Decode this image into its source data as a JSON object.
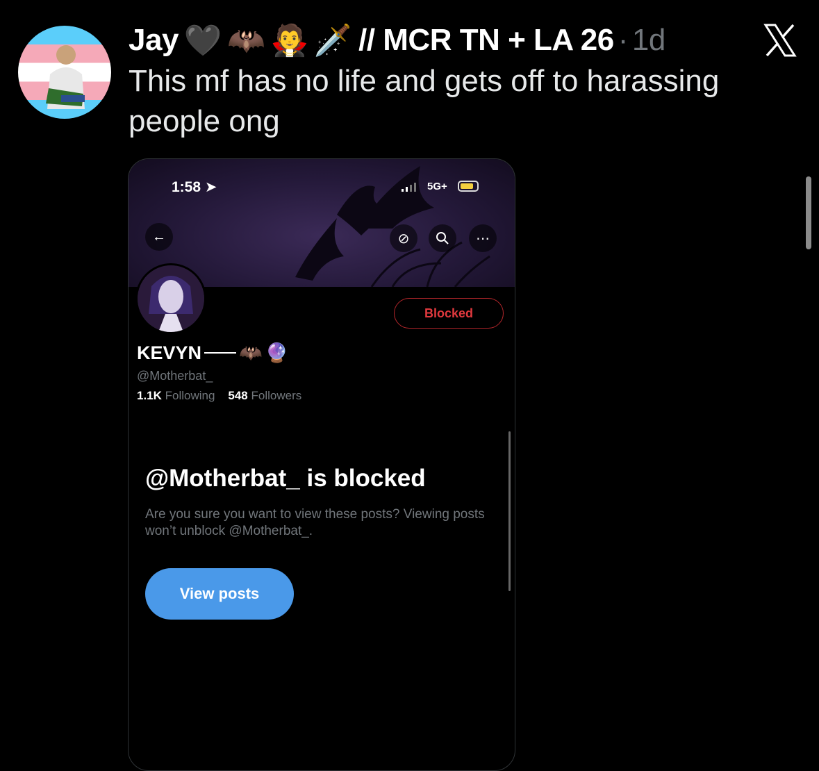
{
  "tweet": {
    "author_name": "Jay",
    "author_emojis": [
      "🖤",
      "🦇",
      "🧛",
      "🗡️"
    ],
    "author_suffix": "// MCR TN + LA 26",
    "separator": "·",
    "age": "1d",
    "text": "This mf has no life and gets off to harassing people ong"
  },
  "embedded": {
    "status": {
      "time": "1:58",
      "network": "5G+"
    },
    "profile": {
      "name": "KEVYN",
      "name_emojis": [
        "🦇",
        "🔮"
      ],
      "handle": "@Motherbat_",
      "following_count": "1.1K",
      "following_label": "Following",
      "followers_count": "548",
      "followers_label": "Followers",
      "blocked_button": "Blocked"
    },
    "blocked_notice": {
      "title": "@Motherbat_ is blocked",
      "subtitle": "Are you sure you want to view these posts? Viewing posts won’t unblock @Motherbat_.",
      "button": "View posts"
    }
  },
  "icons": {
    "close": "close-x-icon",
    "back": "back-arrow-icon",
    "hide": "hide-icon",
    "search": "search-icon",
    "more": "more-icon"
  },
  "colors": {
    "blocked_red": "#e0393e",
    "view_posts_blue": "#4a99e9",
    "muted_text": "#71767b"
  }
}
